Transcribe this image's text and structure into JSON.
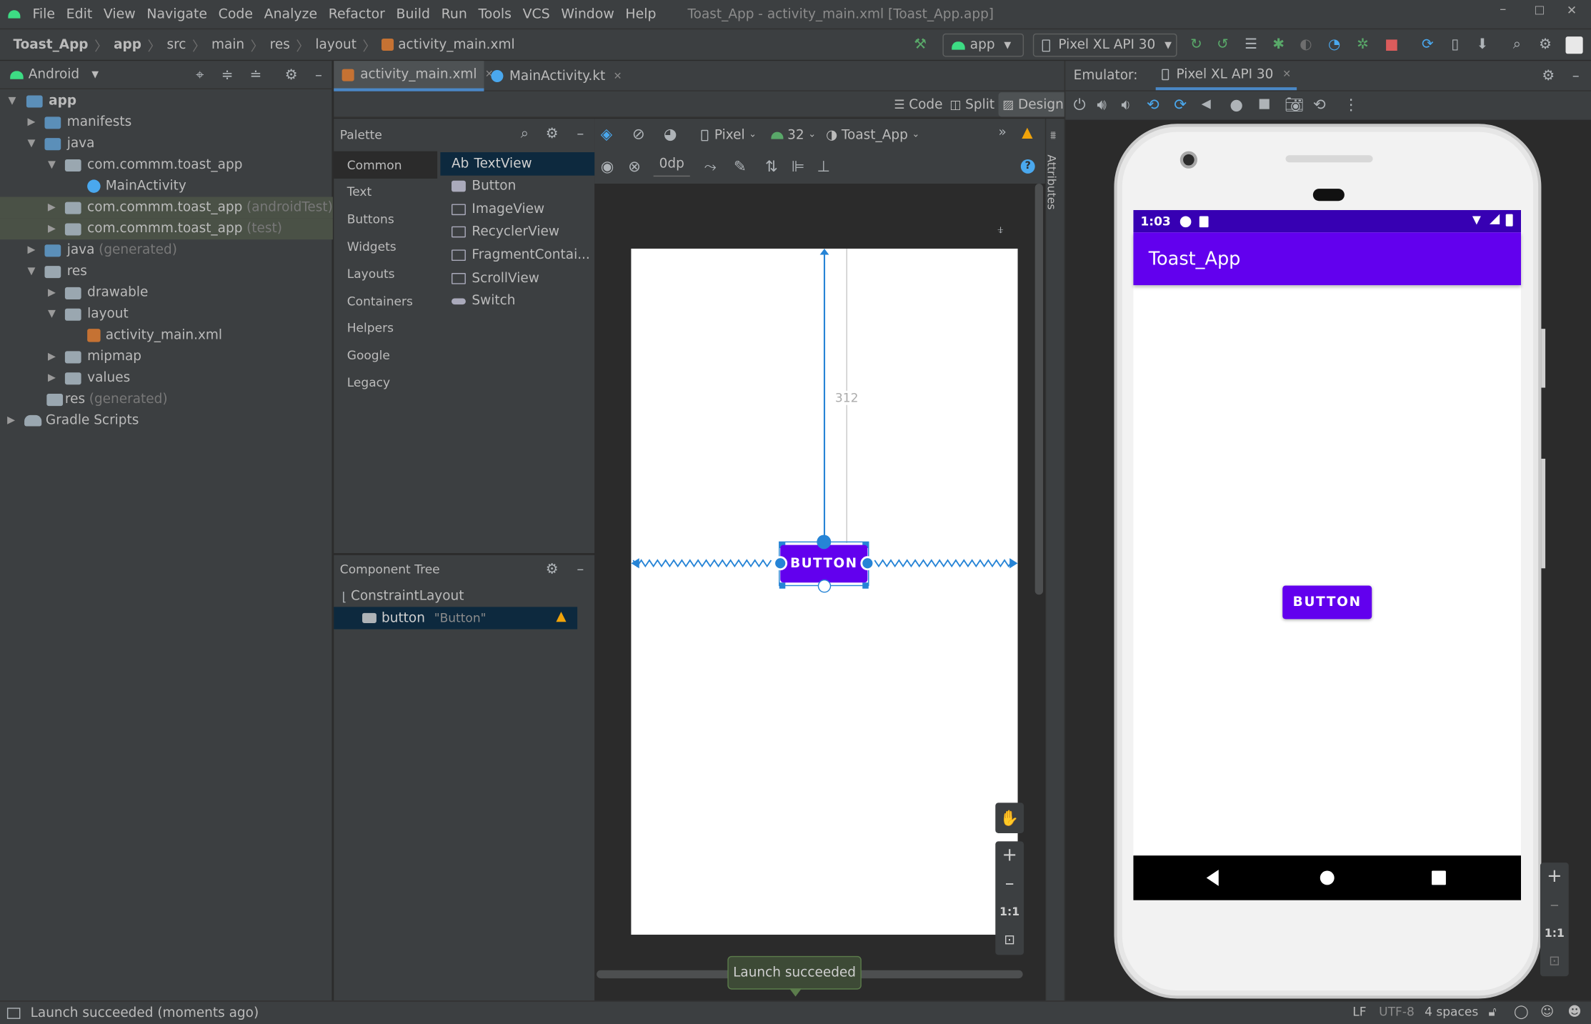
{
  "menu": [
    "File",
    "Edit",
    "View",
    "Navigate",
    "Code",
    "Analyze",
    "Refactor",
    "Build",
    "Run",
    "Tools",
    "VCS",
    "Window",
    "Help"
  ],
  "window_title": "Toast_App - activity_main.xml [Toast_App.app]",
  "breadcrumb": [
    "Toast_App",
    "app",
    "src",
    "main",
    "res",
    "layout",
    "activity_main.xml"
  ],
  "run_config": "app",
  "device_selector": "Pixel XL API 30",
  "project_view": "Android",
  "tree": {
    "app": "app",
    "manifests": "manifests",
    "java": "java",
    "pkg_main": "com.commm.toast_app",
    "main_activity": "MainActivity",
    "pkg_android_test": "com.commm.toast_app",
    "android_test_suffix": "(androidTest)",
    "pkg_test": "com.commm.toast_app",
    "test_suffix": "(test)",
    "java_generated": "java",
    "generated_suffix": "(generated)",
    "res": "res",
    "drawable": "drawable",
    "layout": "layout",
    "activity_main_xml": "activity_main.xml",
    "mipmap": "mipmap",
    "values": "values",
    "res_generated": "res",
    "res_generated_suffix": "(generated)",
    "gradle_scripts": "Gradle Scripts"
  },
  "editor_tabs": [
    "activity_main.xml",
    "MainActivity.kt"
  ],
  "view_modes": {
    "code": "Code",
    "split": "Split",
    "design": "Design"
  },
  "palette": {
    "title": "Palette",
    "categories": [
      "Common",
      "Text",
      "Buttons",
      "Widgets",
      "Layouts",
      "Containers",
      "Helpers",
      "Google",
      "Legacy"
    ],
    "items": [
      "TextView",
      "Button",
      "ImageView",
      "RecyclerView",
      "FragmentContai...",
      "ScrollView",
      "Switch"
    ],
    "textview_prefix": "Ab"
  },
  "design_toolbar": {
    "device": "Pixel",
    "api": "32",
    "theme": "Toast_App",
    "margin": "0dp"
  },
  "attributes_label": "Attributes",
  "canvas": {
    "constraint_value": "312",
    "button_label": "BUTTON"
  },
  "component_tree": {
    "title": "Component Tree",
    "root": "ConstraintLayout",
    "child": "button",
    "child_text": "\"Button\""
  },
  "zoom": {
    "one_to_one": "1:1"
  },
  "emulator": {
    "label": "Emulator:",
    "tab": "Pixel XL API 30",
    "time": "1:03",
    "app_title": "Toast_App",
    "button_label": "BUTTON",
    "one_to_one": "1:1"
  },
  "toast": "Launch succeeded",
  "status": {
    "message": "Launch succeeded (moments ago)",
    "line_sep": "LF",
    "encoding": "UTF-8",
    "indent": "4 spaces"
  },
  "colors": {
    "accent": "#6200ee",
    "status_bar": "#3700b3",
    "selection": "#0d293e",
    "warning": "#f0a30a"
  }
}
